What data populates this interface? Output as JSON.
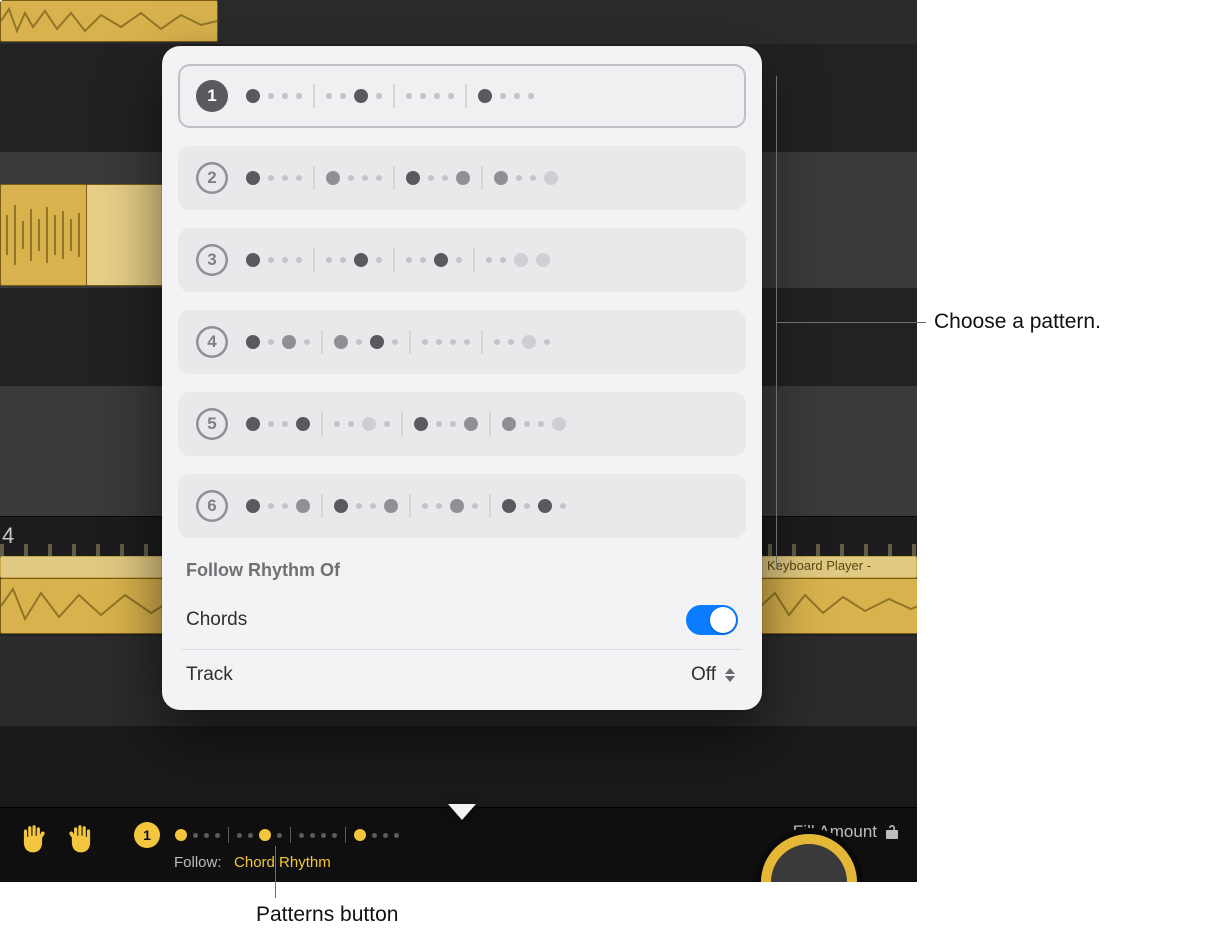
{
  "ruler": {
    "label": "4"
  },
  "region_labels": {
    "keyboard_player": "Keyboard Player -"
  },
  "popover": {
    "patterns": [
      {
        "num": "1",
        "selected": true,
        "seq": [
          "L",
          "S",
          "S",
          "S",
          "bar",
          "S",
          "S",
          "L",
          "S",
          "bar",
          "S",
          "S",
          "S",
          "S",
          "bar",
          "L",
          "S",
          "S",
          "S"
        ]
      },
      {
        "num": "2",
        "selected": false,
        "seq": [
          "L",
          "S",
          "S",
          "S",
          "bar",
          "M",
          "S",
          "S",
          "S",
          "bar",
          "L",
          "S",
          "S",
          "M",
          "bar",
          "M",
          "S",
          "S",
          "W"
        ]
      },
      {
        "num": "3",
        "selected": false,
        "seq": [
          "L",
          "S",
          "S",
          "S",
          "bar",
          "S",
          "S",
          "L",
          "S",
          "bar",
          "S",
          "S",
          "L",
          "S",
          "bar",
          "S",
          "S",
          "W",
          "W"
        ]
      },
      {
        "num": "4",
        "selected": false,
        "seq": [
          "L",
          "S",
          "M",
          "S",
          "bar",
          "M",
          "S",
          "L",
          "S",
          "bar",
          "S",
          "S",
          "S",
          "S",
          "bar",
          "S",
          "S",
          "W",
          "S"
        ]
      },
      {
        "num": "5",
        "selected": false,
        "seq": [
          "L",
          "S",
          "S",
          "L",
          "bar",
          "S",
          "S",
          "W",
          "S",
          "bar",
          "L",
          "S",
          "S",
          "M",
          "bar",
          "M",
          "S",
          "S",
          "W"
        ]
      },
      {
        "num": "6",
        "selected": false,
        "seq": [
          "L",
          "S",
          "S",
          "M",
          "bar",
          "L",
          "S",
          "S",
          "M",
          "bar",
          "S",
          "S",
          "M",
          "S",
          "bar",
          "L",
          "S",
          "L",
          "S"
        ]
      }
    ],
    "section_label": "Follow Rhythm Of",
    "chords_label": "Chords",
    "chords_on": true,
    "track_label": "Track",
    "track_value": "Off"
  },
  "footer": {
    "pattern_num": "1",
    "seq": [
      "L",
      "S",
      "S",
      "S",
      "bar",
      "S",
      "S",
      "L",
      "S",
      "bar",
      "S",
      "S",
      "S",
      "S",
      "bar",
      "L",
      "S",
      "S",
      "S"
    ],
    "follow_label": "Follow:",
    "follow_value": "Chord Rhythm",
    "fill_label": "Fill Amount"
  },
  "callouts": {
    "pattern": "Choose a pattern.",
    "patterns_button": "Patterns button"
  }
}
